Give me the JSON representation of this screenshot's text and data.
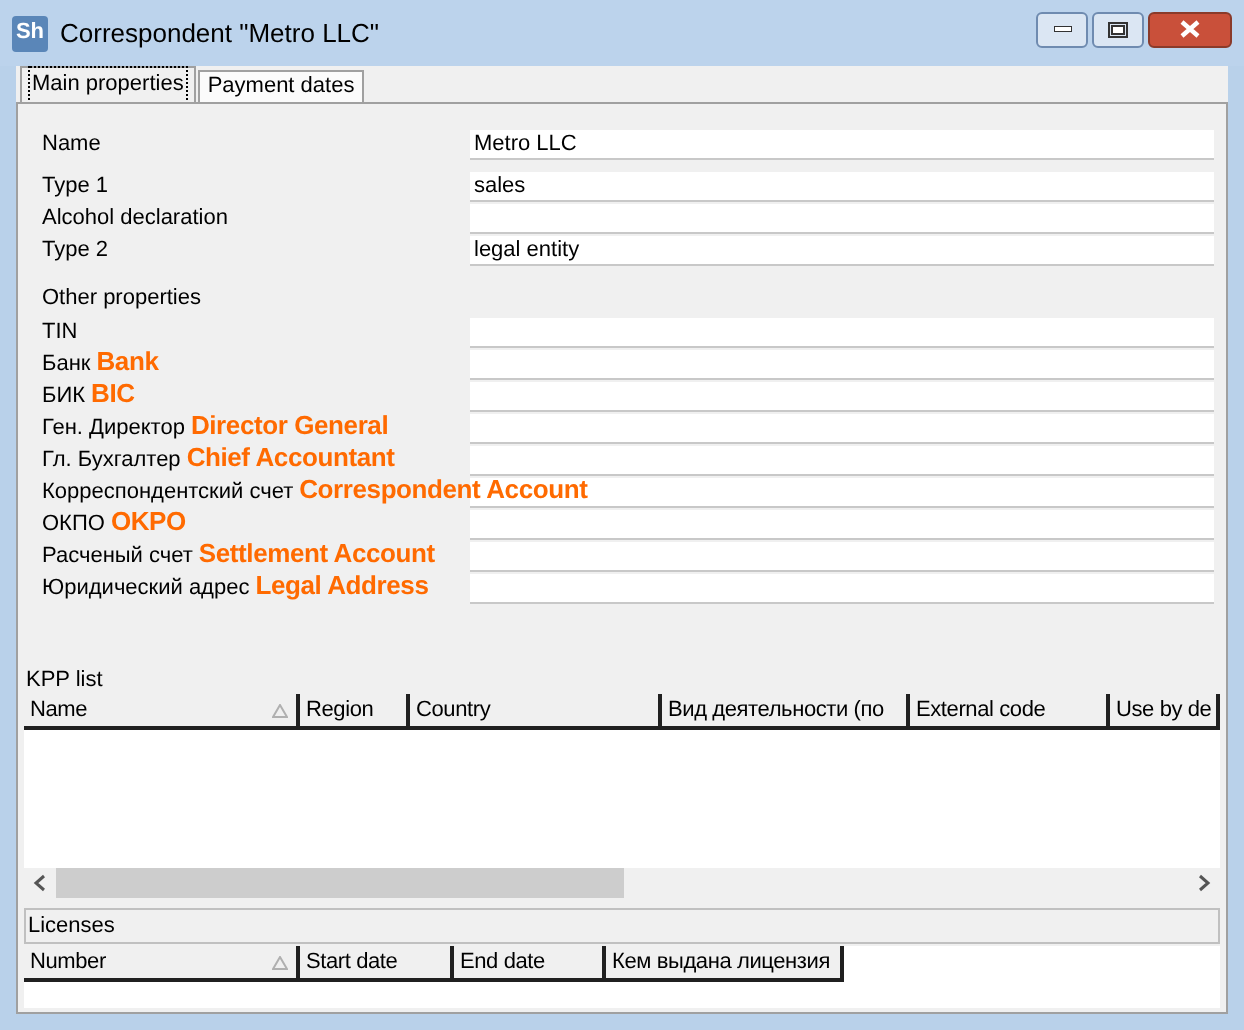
{
  "window": {
    "logo_text": "Sh",
    "title": "Correspondent \"Metro LLC\""
  },
  "tabs": [
    {
      "label": "Main properties",
      "selected": true
    },
    {
      "label": "Payment dates",
      "selected": false
    }
  ],
  "properties": [
    {
      "kind": "field",
      "label": "Name",
      "value": "Metro LLC"
    },
    {
      "kind": "field",
      "label": "Type 1",
      "value": "sales"
    },
    {
      "kind": "field",
      "label": "Alcohol declaration"
    },
    {
      "kind": "field",
      "label": "Type 2",
      "value": "legal entity"
    },
    {
      "kind": "section",
      "label": "Other properties"
    },
    {
      "kind": "field",
      "label": "TIN"
    },
    {
      "kind": "field",
      "label": "Банк",
      "annotation": "Bank"
    },
    {
      "kind": "field",
      "label": "БИК",
      "annotation": "BIC"
    },
    {
      "kind": "field",
      "label": "Ген. Директор",
      "annotation": "Director General"
    },
    {
      "kind": "field",
      "label": "Гл. Бухгалтер",
      "annotation": "Chief Accountant"
    },
    {
      "kind": "field",
      "label": "Корреспондентский счет",
      "annotation": "Correspondent Account"
    },
    {
      "kind": "field",
      "label": "ОКПО",
      "annotation": "OKPO"
    },
    {
      "kind": "field",
      "label": "Расченый счет",
      "annotation": "Settlement Account"
    },
    {
      "kind": "field",
      "label": "Юридический адрес",
      "annotation": "Legal Address"
    }
  ],
  "kpp_list": {
    "title": "KPP list",
    "columns": [
      {
        "label": "Name",
        "sorted": true
      },
      {
        "label": "Region",
        "sorted": false
      },
      {
        "label": "Country",
        "sorted": false
      },
      {
        "label": "Вид деятельности (по",
        "sorted": false
      },
      {
        "label": "External code",
        "sorted": false
      },
      {
        "label": "Use by de",
        "sorted": false
      }
    ]
  },
  "licenses": {
    "title": "Licenses",
    "columns": [
      {
        "label": "Number",
        "sorted": true
      },
      {
        "label": "Start date",
        "sorted": false
      },
      {
        "label": "End date",
        "sorted": false
      },
      {
        "label": "Кем выдана лицензия",
        "sorted": false
      }
    ]
  }
}
